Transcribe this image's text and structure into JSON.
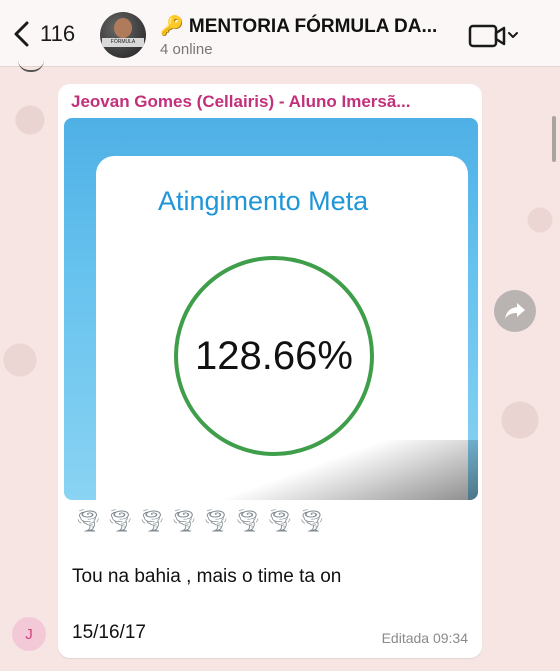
{
  "header": {
    "back_count": "116",
    "title": "🔑 MENTORIA FÓRMULA DA...",
    "status": "4 online",
    "avatar_text": "FÓRMULA DA DIVISÃO"
  },
  "message": {
    "sender": "Jeovan Gomes (Cellairis) - Aluno Imersã...",
    "image": {
      "card_title": "Atingimento Meta",
      "gauge_value": "128.66%"
    },
    "emojis": "🌪🌪🌪🌪🌪🌪🌪🌪",
    "text": "Tou na bahia , mais o time ta on",
    "date_text": "15/16/17",
    "meta": "Editada 09:34"
  },
  "reply_avatar_letter": "J",
  "colors": {
    "sender": "#c2307b",
    "card_title": "#1e96d8",
    "gauge_ring": "#3f9e4a",
    "background": "#f6e5e3"
  }
}
